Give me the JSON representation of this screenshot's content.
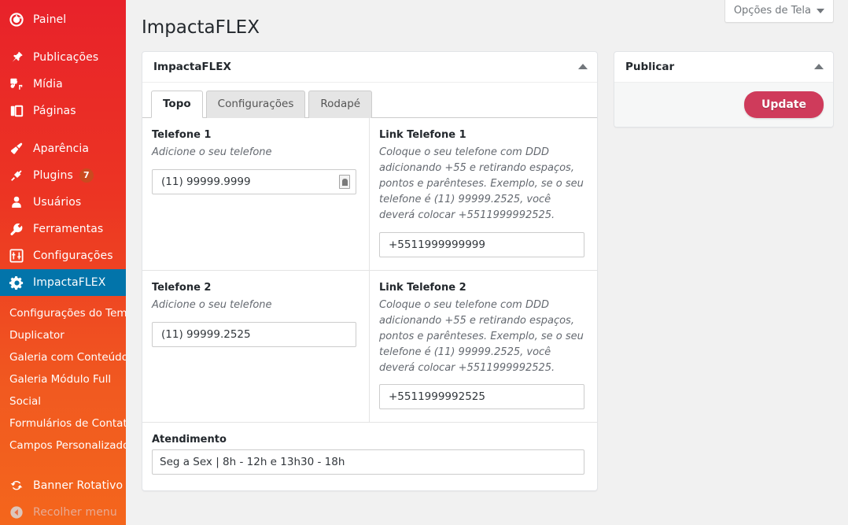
{
  "sidebar": {
    "items": [
      {
        "label": "Painel",
        "icon": "dashboard-icon",
        "active": false
      },
      {
        "label": "Publicações",
        "icon": "pin-icon",
        "active": false
      },
      {
        "label": "Mídia",
        "icon": "media-icon",
        "active": false
      },
      {
        "label": "Páginas",
        "icon": "pages-icon",
        "active": false
      },
      {
        "label": "Aparência",
        "icon": "paintbrush-icon",
        "active": false
      },
      {
        "label": "Plugins",
        "icon": "plugin-icon",
        "badge": "7",
        "active": false
      },
      {
        "label": "Usuários",
        "icon": "user-icon",
        "active": false
      },
      {
        "label": "Ferramentas",
        "icon": "wrench-icon",
        "active": false
      },
      {
        "label": "Configurações",
        "icon": "sliders-icon",
        "active": false
      },
      {
        "label": "ImpactaFLEX",
        "icon": "gear-icon",
        "active": true
      }
    ],
    "submenu": [
      "Configurações do Tema",
      "Duplicator",
      "Galeria com Conteúdo",
      "Galeria Módulo Full",
      "Social",
      "Formulários de Contato",
      "Campos Personalizados"
    ],
    "banner_item": {
      "label": "Banner Rotativo",
      "icon": "update-circle-icon"
    },
    "collapse_item": {
      "label": "Recolher menu",
      "icon": "collapse-arrow-icon"
    },
    "active_color": "#0274aa",
    "badge_color": "#ca4a1f"
  },
  "header": {
    "screen_options_label": "Opções de Tela",
    "page_title": "ImpactaFLEX"
  },
  "panel": {
    "title": "ImpactaFLEX",
    "tabs": [
      {
        "label": "Topo",
        "active": true
      },
      {
        "label": "Configurações",
        "active": false
      },
      {
        "label": "Rodapé",
        "active": false
      }
    ],
    "fields": [
      {
        "label": "Telefone 1",
        "desc": "Adicione o seu telefone",
        "value": "(11) 99999.9999",
        "placeholder": "",
        "has_autofill_icon": true
      },
      {
        "label": "Link Telefone 1",
        "desc": "Coloque o seu telefone com DDD adicionando +55 e retirando espaços, pontos e parênteses. Exemplo, se o seu telefone é (11) 99999.2525, você deverá colocar +5511999992525.",
        "value": "+5511999999999",
        "placeholder": "",
        "has_autofill_icon": false
      },
      {
        "label": "Telefone 2",
        "desc": "Adicione o seu telefone",
        "value": "(11) 99999.2525",
        "placeholder": "",
        "has_autofill_icon": false
      },
      {
        "label": "Link Telefone 2",
        "desc": "Coloque o seu telefone com DDD adicionando +55 e retirando espaços, pontos e parênteses. Exemplo, se o seu telefone é (11) 99999.2525, você deverá colocar +5511999992525.",
        "value": "+5511999992525",
        "placeholder": "",
        "has_autofill_icon": false
      }
    ],
    "atendimento": {
      "label": "Atendimento",
      "value": "Seg a Sex | 8h - 12h e 13h30 - 18h",
      "placeholder": ""
    }
  },
  "publish": {
    "title": "Publicar",
    "update_label": "Update",
    "update_color": "#cf3b5b"
  }
}
